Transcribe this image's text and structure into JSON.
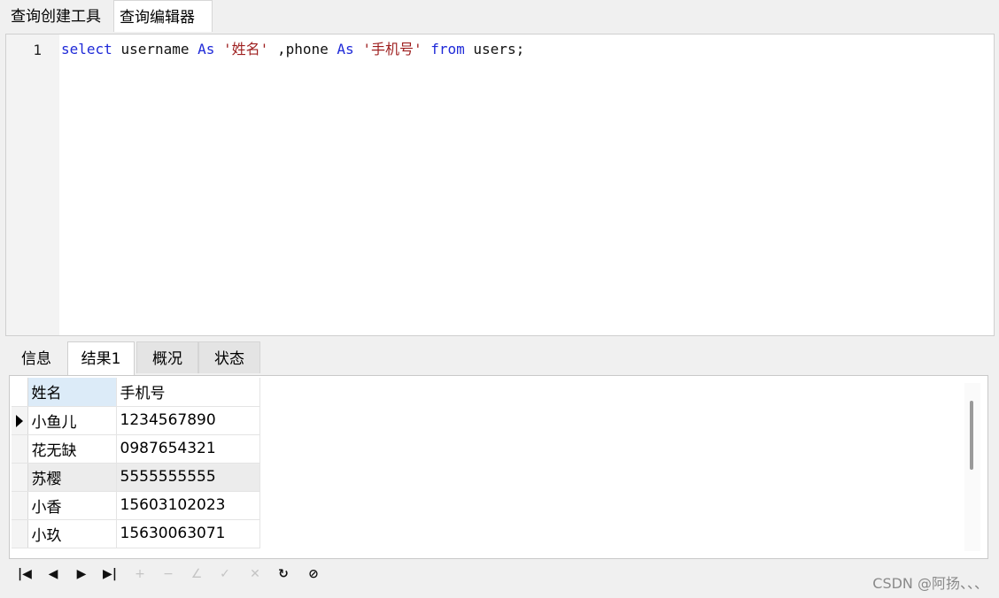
{
  "top_tabs": [
    "查询创建工具",
    "查询编辑器"
  ],
  "editor": {
    "line_number": "1",
    "code": {
      "select": "select",
      "username": "username",
      "as1": "As",
      "alias1": "'姓名'",
      "phone": ",phone",
      "as2": "As",
      "alias2": "'手机号'",
      "from": "from",
      "tail": "users;"
    }
  },
  "result_tabs": [
    "信息",
    "结果1",
    "概况",
    "状态"
  ],
  "results": {
    "columns": [
      "姓名",
      "手机号"
    ],
    "rows": [
      {
        "name": "小鱼儿",
        "phone": "1234567890"
      },
      {
        "name": "花无缺",
        "phone": "0987654321"
      },
      {
        "name": "苏樱",
        "phone": "5555555555"
      },
      {
        "name": "小香",
        "phone": "15603102023"
      },
      {
        "name": "小玖",
        "phone": "15630063071"
      }
    ]
  },
  "toolbar_icons": [
    "first-record-icon",
    "prev-record-icon",
    "next-record-icon",
    "last-record-icon",
    "add-record-icon",
    "delete-record-icon",
    "edit-record-icon",
    "apply-icon",
    "cancel-icon",
    "refresh-icon",
    "stop-icon"
  ],
  "watermark": "CSDN @阿扬、、、"
}
